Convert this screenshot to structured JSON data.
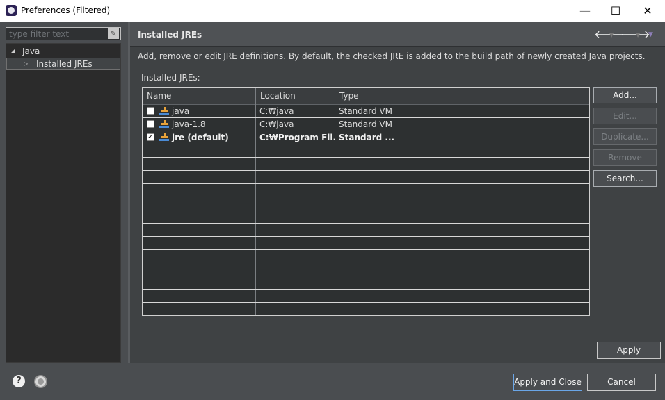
{
  "window": {
    "title": "Preferences (Filtered)",
    "minimize_glyph": "—",
    "maximize_glyph": "☐",
    "close_glyph": "✕"
  },
  "left": {
    "filter_placeholder": "type filter text",
    "filter_clear_icon": "eraser-icon",
    "tree": [
      {
        "label": "Java",
        "expanded": true
      },
      {
        "label": "Installed JREs",
        "selected": true
      }
    ]
  },
  "page": {
    "title": "Installed JREs",
    "description": "Add, remove or edit JRE definitions. By default, the checked JRE is added to the build path of newly created Java projects.",
    "table_caption": "Installed JREs:",
    "columns": [
      "Name",
      "Location",
      "Type"
    ],
    "rows": [
      {
        "checked": false,
        "name": "java",
        "location": "C:₩java",
        "type": "Standard VM",
        "bold": false
      },
      {
        "checked": false,
        "name": "java-1.8",
        "location": "C:₩java",
        "type": "Standard VM",
        "bold": false
      },
      {
        "checked": true,
        "name": "jre (default)",
        "location": "C:₩Program Fil...",
        "type": "Standard ...",
        "bold": true
      }
    ],
    "buttons": {
      "add": "Add...",
      "edit": "Edit...",
      "duplicate": "Duplicate...",
      "remove": "Remove",
      "search": "Search..."
    },
    "apply": "Apply"
  },
  "footer": {
    "apply_close": "Apply and Close",
    "cancel": "Cancel"
  },
  "colors": {
    "background": "#4a4d50",
    "table_bg": "#2d3031",
    "accent_border": "#6aa6e8"
  }
}
